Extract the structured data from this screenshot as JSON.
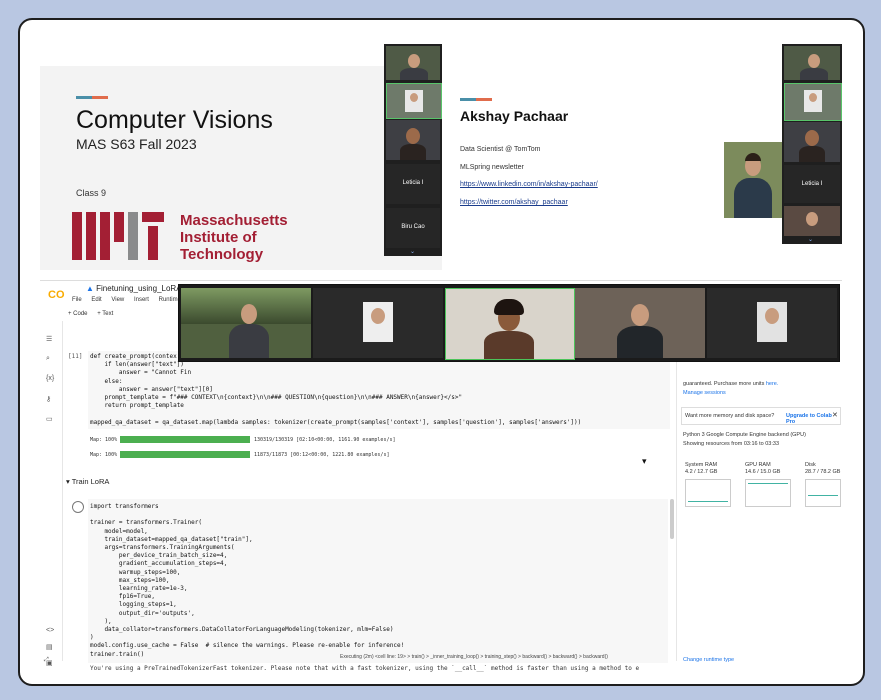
{
  "slide1": {
    "title": "Computer Visions",
    "subtitle": "MAS S63 Fall 2023",
    "class": "Class 9",
    "mit_line1": "Massachusetts",
    "mit_line2": "Institute of",
    "mit_line3": "Technology"
  },
  "slide2": {
    "name": "Akshay Pachaar",
    "role": "Data Scientist @ TomTom",
    "newsletter": "MLSpring newsletter",
    "linkedin": "https://www.linkedin.com/in/akshay-pachaar/",
    "twitter": "https://twitter.com/akshay_pachaar"
  },
  "participants": {
    "leticia": "Leticia I",
    "biru": "Biru Cao"
  },
  "colab": {
    "logo": "CO",
    "notebook_title": "Finetuning_using_LoRA_bl",
    "menu": [
      "File",
      "Edit",
      "View",
      "Insert",
      "Runtime"
    ],
    "add_code": "+ Code",
    "add_text": "+ Text",
    "cell_number": "[11]",
    "code_cell1": [
      "def create_prompt(contex",
      "    if len(answer[\"text\"])",
      "        answer = \"Cannot Fin",
      "    else:",
      "        answer = answer[\"text\"][0]",
      "    prompt_template = f\"### CONTEXT\\n{context}\\n\\n### QUESTION\\n{question}\\n\\n### ANSWER\\n{answer}</s>\"",
      "    return prompt_template",
      "",
      "mapped_qa_dataset = qa_dataset.map(lambda samples: tokenizer(create_prompt(samples['context'], samples['question'], samples['answers']))"
    ],
    "progress1_label": "Map: 100%",
    "progress1_info": "130319/130319 [02:10<00:00, 1161.90 examples/s]",
    "progress2_label": "Map: 100%",
    "progress2_info": "11873/11873 [00:12<00:00, 1221.80 examples/s]",
    "section_title": "Train LoRA",
    "code_cell2": [
      "import transformers",
      "",
      "trainer = transformers.Trainer(",
      "    model=model,",
      "    train_dataset=mapped_qa_dataset[\"train\"],",
      "    args=transformers.TrainingArguments(",
      "        per_device_train_batch_size=4,",
      "        gradient_accumulation_steps=4,",
      "        warmup_steps=100,",
      "        max_steps=100,",
      "        learning_rate=1e-3,",
      "        fp16=True,",
      "        logging_steps=1,",
      "        output_dir='outputs',",
      "    ),",
      "    data_collator=transformers.DataCollatorForLanguageModeling(tokenizer, mlm=False)",
      ")",
      "model.config.use_cache = False  # silence the warnings. Please re-enable for inference!",
      "trainer.train()"
    ],
    "output_text": "You're using a PreTrainedTokenizerFast tokenizer. Please note that with a fast tokenizer, using the `__call__` method is faster than using a method to e",
    "status_bar": "Executing (2m)  <cell line: 19>  > train()  > _inner_training_loop()  > training_step()  > backward()  > backward()  > backward()"
  },
  "right_panel": {
    "guaranteed": "guaranteed. Purchase more units",
    "here": "here.",
    "manage_sessions": "Manage sessions",
    "want_more": "Want more memory and disk space?",
    "upgrade": "Upgrade to Colab Pro",
    "backend": "Python 3 Google Compute Engine backend (GPU)",
    "showing": "Showing resources from 03:16 to 03:33",
    "gauges": [
      {
        "name": "System RAM",
        "value": "4.2 / 12.7 GB"
      },
      {
        "name": "GPU RAM",
        "value": "14.6 / 15.0 GB"
      },
      {
        "name": "Disk",
        "value": "28.7 / 78.2 GB"
      }
    ],
    "change_runtime": "Change runtime type"
  }
}
